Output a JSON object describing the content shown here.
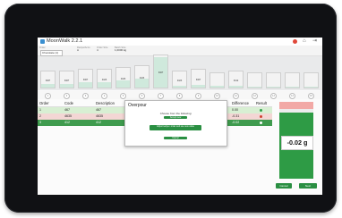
{
  "app": {
    "title": "MoonWalk 2.2.1"
  },
  "info_bar": [
    {
      "label": "Order",
      "value": "Chocolate (1)"
    },
    {
      "label": "Recipe/Acco",
      "value": "A"
    },
    {
      "label": "Order Size",
      "value": "4"
    },
    {
      "label": "Batch Size",
      "value": "1,0000 kg"
    }
  ],
  "bars": [
    {
      "label": "3467",
      "fill": 0.25
    },
    {
      "label": "3467",
      "fill": 0.25
    },
    {
      "label": "3467",
      "fill": 0.3
    },
    {
      "label": "4423",
      "fill": 0.3
    },
    {
      "label": "4423",
      "fill": 0.35
    },
    {
      "label": "4423",
      "fill": 0.4
    },
    {
      "label": "3467",
      "fill": 0.95
    },
    {
      "label": "4423",
      "fill": 0.1
    },
    {
      "label": "3467",
      "fill": 0.15
    },
    {
      "label": "",
      "fill": 0.1
    },
    {
      "label": "3412",
      "fill": 0.12
    },
    {
      "label": "",
      "fill": 0.05
    },
    {
      "label": "",
      "fill": 0.05
    },
    {
      "label": "",
      "fill": 0.05
    },
    {
      "label": "",
      "fill": 0.05
    }
  ],
  "step_circles": [
    "1",
    "2",
    "3",
    "4",
    "5",
    "6",
    "7",
    "8",
    "9",
    "10",
    "11",
    "12",
    "13",
    "14",
    "15"
  ],
  "table": {
    "headers": [
      "Order",
      "Code",
      "Description",
      "Difference",
      "Result"
    ],
    "rows": [
      {
        "order": "1",
        "code": "467",
        "description": "467",
        "difference": "0.00",
        "result": "ok"
      },
      {
        "order": "2",
        "code": "4635",
        "description": "4635",
        "difference": "-0.31",
        "result": "fail"
      },
      {
        "order": "3",
        "code": "412",
        "description": "412",
        "difference": "-0.02",
        "result": "active"
      }
    ]
  },
  "weight_display": {
    "value": "-0.02 g"
  },
  "footer": {
    "cancel_label": "Cancel",
    "next_label": "Next"
  },
  "modal": {
    "title": "Overpour",
    "message": "Choose from the following:",
    "btn1": "Accept new",
    "btn2": "Adjust recipe / order and use new value",
    "btn3": "Cancel"
  }
}
